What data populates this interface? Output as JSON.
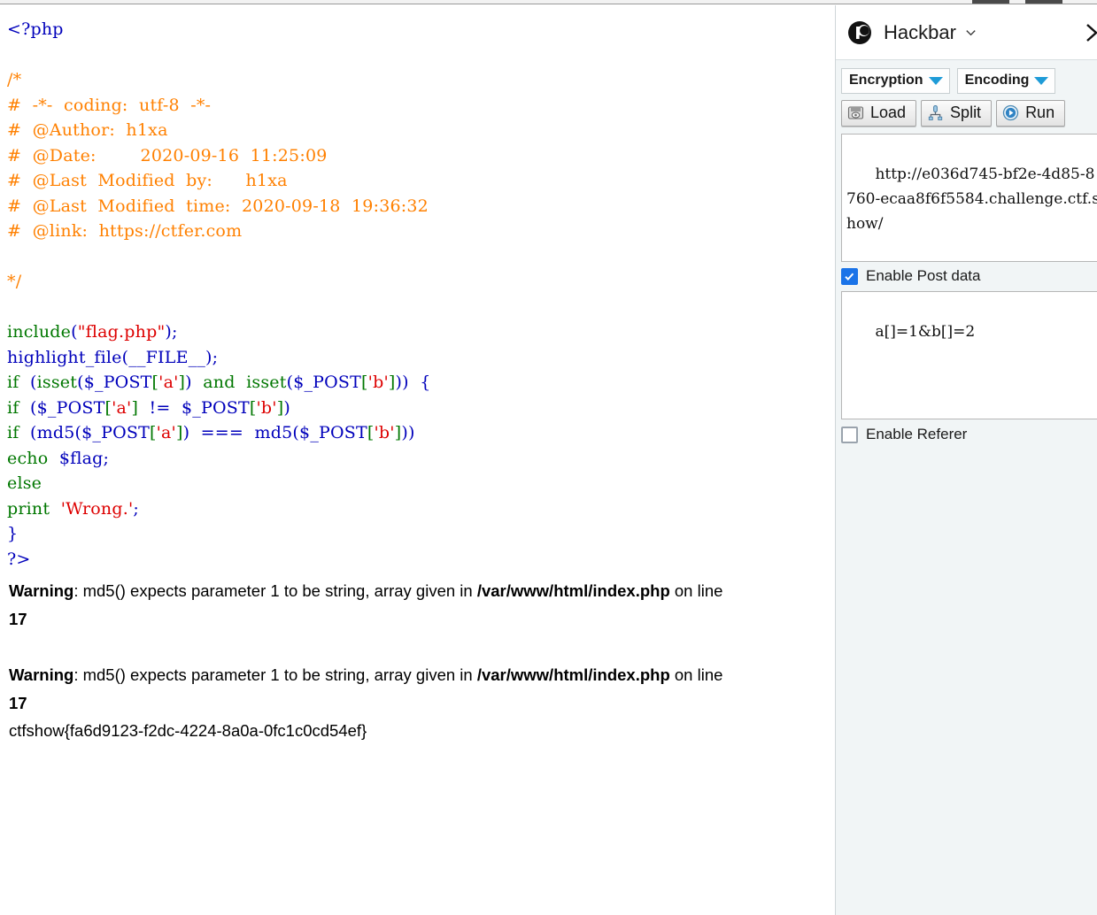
{
  "browser": {
    "top_strip_present": true
  },
  "page": {
    "code_lines": [
      [
        {
          "t": "<?php",
          "c": "php"
        }
      ],
      [
        {
          "t": "",
          "c": "def"
        }
      ],
      [
        {
          "t": "/*",
          "c": "cmt"
        }
      ],
      [
        {
          "t": "#  -*-  coding:  utf-8  -*-",
          "c": "cmt"
        }
      ],
      [
        {
          "t": "#  @Author:  h1xa",
          "c": "cmt"
        }
      ],
      [
        {
          "t": "#  @Date:        2020-09-16  11:25:09",
          "c": "cmt"
        }
      ],
      [
        {
          "t": "#  @Last  Modified  by:      h1xa",
          "c": "cmt"
        }
      ],
      [
        {
          "t": "#  @Last  Modified  time:  2020-09-18  19:36:32",
          "c": "cmt"
        }
      ],
      [
        {
          "t": "#  @link:  https://ctfer.com",
          "c": "cmt"
        }
      ],
      [
        {
          "t": "",
          "c": "def"
        }
      ],
      [
        {
          "t": "*/",
          "c": "cmt"
        }
      ],
      [
        {
          "t": "",
          "c": "def"
        }
      ],
      [
        {
          "t": "include",
          "c": "kw"
        },
        {
          "t": "(",
          "c": "fn"
        },
        {
          "t": "\"flag.php\"",
          "c": "str"
        },
        {
          "t": ");",
          "c": "fn"
        }
      ],
      [
        {
          "t": "highlight_file",
          "c": "fn"
        },
        {
          "t": "(",
          "c": "fn"
        },
        {
          "t": "__FILE__",
          "c": "fn"
        },
        {
          "t": ");",
          "c": "fn"
        }
      ],
      [
        {
          "t": "if",
          "c": "kw"
        },
        {
          "t": "  (",
          "c": "fn"
        },
        {
          "t": "isset",
          "c": "kw"
        },
        {
          "t": "(",
          "c": "fn"
        },
        {
          "t": "$_POST",
          "c": "fn"
        },
        {
          "t": "[",
          "c": "kw"
        },
        {
          "t": "'a'",
          "c": "str"
        },
        {
          "t": "]",
          "c": "kw"
        },
        {
          "t": ")",
          "c": "fn"
        },
        {
          "t": "  ",
          "c": "def"
        },
        {
          "t": "and",
          "c": "kw"
        },
        {
          "t": "  ",
          "c": "def"
        },
        {
          "t": "isset",
          "c": "kw"
        },
        {
          "t": "(",
          "c": "fn"
        },
        {
          "t": "$_POST",
          "c": "fn"
        },
        {
          "t": "[",
          "c": "kw"
        },
        {
          "t": "'b'",
          "c": "str"
        },
        {
          "t": "]",
          "c": "kw"
        },
        {
          "t": "))",
          "c": "fn"
        },
        {
          "t": "  {",
          "c": "fn"
        }
      ],
      [
        {
          "t": "if",
          "c": "kw"
        },
        {
          "t": "  (",
          "c": "fn"
        },
        {
          "t": "$_POST",
          "c": "fn"
        },
        {
          "t": "[",
          "c": "kw"
        },
        {
          "t": "'a'",
          "c": "str"
        },
        {
          "t": "]",
          "c": "kw"
        },
        {
          "t": "  !=  ",
          "c": "fn"
        },
        {
          "t": "$_POST",
          "c": "fn"
        },
        {
          "t": "[",
          "c": "kw"
        },
        {
          "t": "'b'",
          "c": "str"
        },
        {
          "t": "]",
          "c": "kw"
        },
        {
          "t": ")",
          "c": "fn"
        }
      ],
      [
        {
          "t": "if",
          "c": "kw"
        },
        {
          "t": "  (",
          "c": "fn"
        },
        {
          "t": "md5",
          "c": "fn"
        },
        {
          "t": "(",
          "c": "fn"
        },
        {
          "t": "$_POST",
          "c": "fn"
        },
        {
          "t": "[",
          "c": "kw"
        },
        {
          "t": "'a'",
          "c": "str"
        },
        {
          "t": "]",
          "c": "kw"
        },
        {
          "t": ")",
          "c": "fn"
        },
        {
          "t": "  ===  ",
          "c": "fn"
        },
        {
          "t": "md5",
          "c": "fn"
        },
        {
          "t": "(",
          "c": "fn"
        },
        {
          "t": "$_POST",
          "c": "fn"
        },
        {
          "t": "[",
          "c": "kw"
        },
        {
          "t": "'b'",
          "c": "str"
        },
        {
          "t": "]",
          "c": "kw"
        },
        {
          "t": "))",
          "c": "fn"
        }
      ],
      [
        {
          "t": "echo",
          "c": "kw"
        },
        {
          "t": "  ",
          "c": "def"
        },
        {
          "t": "$flag",
          "c": "fn"
        },
        {
          "t": ";",
          "c": "fn"
        }
      ],
      [
        {
          "t": "else",
          "c": "kw"
        }
      ],
      [
        {
          "t": "print",
          "c": "kw"
        },
        {
          "t": "  ",
          "c": "def"
        },
        {
          "t": "'Wrong.'",
          "c": "str"
        },
        {
          "t": ";",
          "c": "fn"
        }
      ],
      [
        {
          "t": "}",
          "c": "fn"
        }
      ],
      [
        {
          "t": "?>",
          "c": "php"
        }
      ]
    ],
    "warnings": [
      {
        "label": "Warning",
        "message": ": md5() expects parameter 1 to be string, array given in ",
        "file": "/var/www/html/index.php",
        "on_line_text": " on line ",
        "line_number": "17"
      },
      {
        "label": "Warning",
        "message": ": md5() expects parameter 1 to be string, array given in ",
        "file": "/var/www/html/index.php",
        "on_line_text": " on line ",
        "line_number": "17"
      }
    ],
    "flag": "ctfshow{fa6d9123-f2dc-4224-8a0a-0fc1c0cd54ef}"
  },
  "hackbar": {
    "title": "Hackbar",
    "logo_icon": "hackbar-logo-icon",
    "caret_icon": "chevron-down-icon",
    "close_icon": "chevron-right-icon",
    "dropdowns": [
      {
        "label": "Encryption",
        "icon": "caret-down-icon"
      },
      {
        "label": "Encoding",
        "icon": "caret-down-icon"
      }
    ],
    "tools": [
      {
        "label": "Load",
        "icon": "load-disk-icon"
      },
      {
        "label": "Split",
        "icon": "split-fork-icon"
      },
      {
        "label": "Run",
        "icon": "play-circle-icon"
      }
    ],
    "url_field": {
      "value": "http://e036d745-bf2e-4d85-8760-ecaa8f6f5584.challenge.ctf.show/",
      "placeholder": "URL"
    },
    "post_checkbox": {
      "label": "Enable Post data",
      "checked": true
    },
    "post_field": {
      "value": "a[]=1&b[]=2",
      "placeholder": "Post data"
    },
    "referer_checkbox": {
      "label": "Enable Referer",
      "checked": false
    }
  },
  "colors": {
    "php_tag": "#0000bb",
    "comment": "#ff8000",
    "keyword": "#007700",
    "string": "#dd0000",
    "function": "#0000bb",
    "accent_blue": "#1e9bd7",
    "checkbox_blue": "#1a73e8",
    "panel_bg": "#f1f5f6"
  }
}
